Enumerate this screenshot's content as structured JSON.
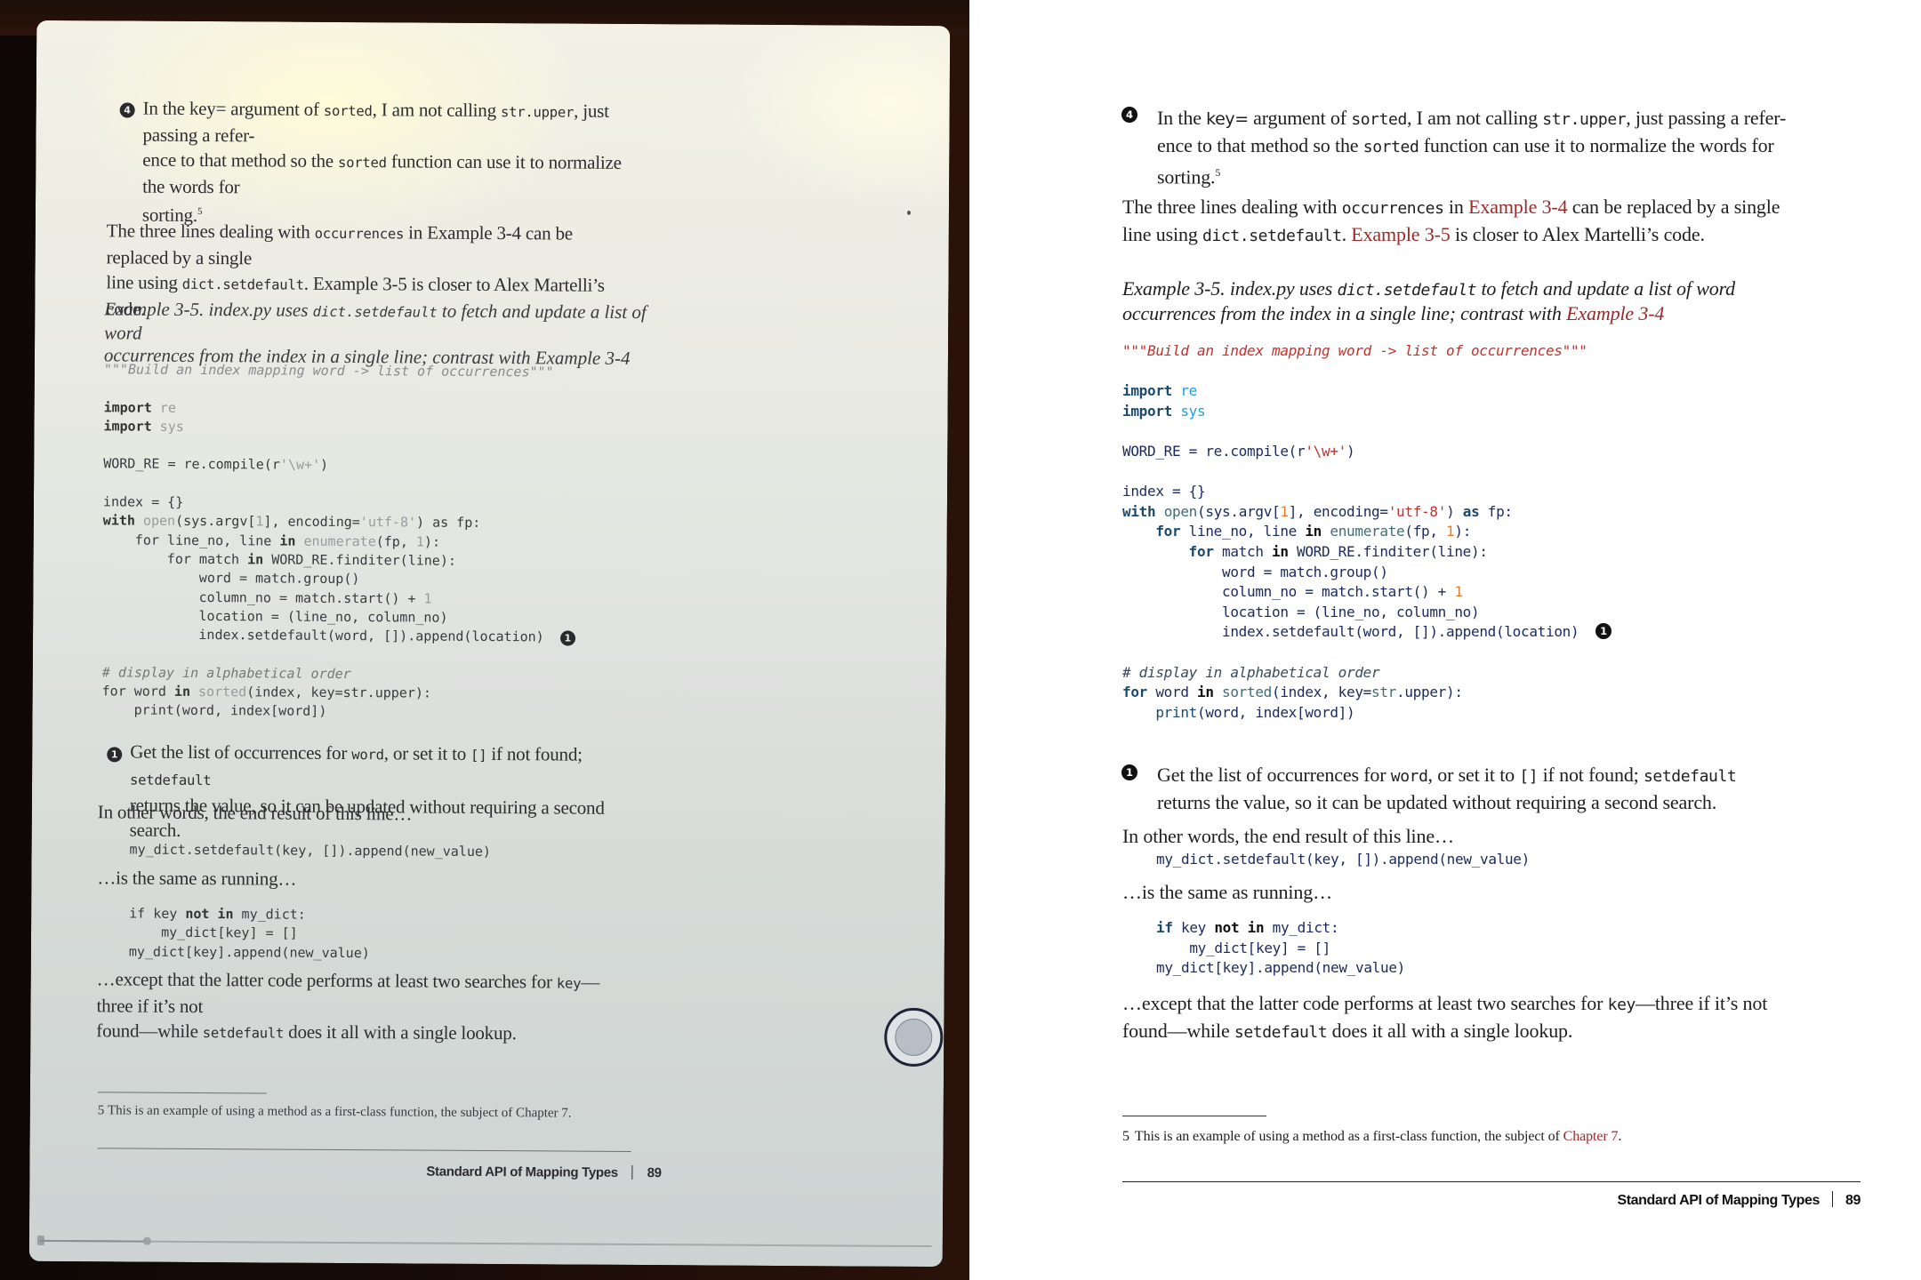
{
  "photo": {
    "description": "Photo of e-ink reader displaying the same book page",
    "progress": {
      "fraction": 0.12
    },
    "floating_button": "page-turn-button"
  },
  "book": {
    "callout4": {
      "marker": "4",
      "parts": [
        "In the ",
        "key=",
        " argument of ",
        "sorted",
        ", I am not calling ",
        "str.upper",
        ", just passing a refer-",
        "ence to that method so the ",
        "sorted",
        " function can use it to normalize the words for",
        "sorting.",
        "5"
      ]
    },
    "para1": {
      "parts": [
        "The three lines dealing with ",
        "occurrences",
        " in ",
        "Example 3-4",
        " can be replaced by a single",
        "line using ",
        "dict.setdefault",
        ". ",
        "Example 3-5",
        " is closer to Alex Martelli’s code."
      ]
    },
    "caption": {
      "parts": [
        "Example 3-5. index.py uses ",
        "dict.setdefault",
        " to fetch and update a list of word",
        "occurrences from the index in a single line; contrast with ",
        "Example 3-4"
      ]
    },
    "code": {
      "docstring": "\"\"\"Build an index mapping word -> list of occurrences\"\"\"",
      "import_kw": "import",
      "mod_re": "re",
      "mod_sys": "sys",
      "word_re_line": [
        "WORD_RE = re.compile(r",
        "'\\w+'",
        ")"
      ],
      "index_line": "index = {}",
      "with_line": [
        "with",
        " ",
        "open",
        "(sys.argv[",
        "1",
        "], encoding=",
        "'utf-8'",
        ") ",
        "as",
        " fp:"
      ],
      "for1_line": [
        "for",
        " line_no, line ",
        "in",
        " ",
        "enumerate",
        "(fp, ",
        "1",
        "):"
      ],
      "for2_line": [
        "for",
        " match ",
        "in",
        " WORD_RE.finditer(line):"
      ],
      "word_line": "word = match.group()",
      "column_line": [
        "column_no = match.start() + ",
        "1"
      ],
      "location_line": "location = (line_no, column_no)",
      "setdefault_line": "index.setdefault(word, []).append(location)",
      "callout_marker": "1",
      "comment": "# display in alphabetical order",
      "for3_line": [
        "for",
        " word ",
        "in",
        " ",
        "sorted",
        "(index, key=",
        "str",
        ".upper):"
      ],
      "print_line": [
        "print",
        "(word, index[word])"
      ]
    },
    "callout1": {
      "marker": "1",
      "parts": [
        "Get the list of occurrences for ",
        "word",
        ", or set it to ",
        "[]",
        " if not found; ",
        "setdefault",
        "returns the value, so it can be updated without requiring a second search."
      ]
    },
    "para2": "In other words, the end result of this line…",
    "snippet1": "my_dict.setdefault(key, []).append(new_value)",
    "para3": "…is the same as running…",
    "snippet2": {
      "line1": [
        "if",
        " key ",
        "not in",
        " my_dict:"
      ],
      "line2": "my_dict[key] = []",
      "line3": "my_dict[key].append(new_value)"
    },
    "para4": {
      "parts": [
        "…except that the latter code performs at least two searches for ",
        "key",
        "—three if it’s not",
        "found—while ",
        "setdefault",
        " does it all with a single lookup."
      ]
    },
    "footnote": {
      "number": "5",
      "text": "This is an example of using a method as a first-class function, the subject of ",
      "link": "Chapter 7",
      "end": "."
    },
    "running_footer": {
      "title": "Standard API of Mapping Types",
      "page_number": "89"
    }
  },
  "colors": {
    "link": "#9a2a2a",
    "keyword": "#1a4a6e",
    "module": "#1ea0d6",
    "string": "#c4302b",
    "number": "#e47a2a",
    "name": "#1b2a5e"
  }
}
